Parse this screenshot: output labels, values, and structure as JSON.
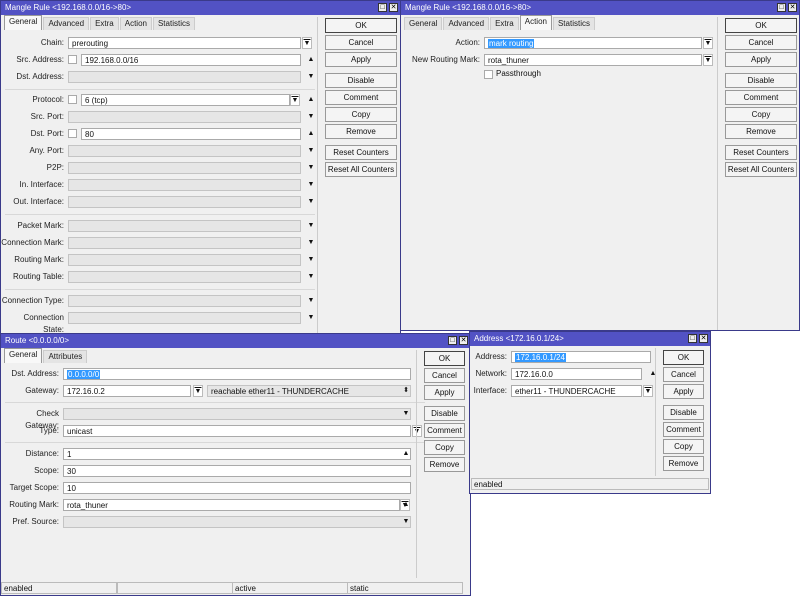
{
  "mangle_general": {
    "title": "Mangle Rule <192.168.0.0/16->80>",
    "tabs": [
      "General",
      "Advanced",
      "Extra",
      "Action",
      "Statistics"
    ],
    "active_tab": 0,
    "rows": [
      {
        "label": "Chain:",
        "value": "prerouting",
        "kind": "text",
        "arrow": "dropdown-icon"
      },
      {
        "label": "Src. Address:",
        "value": "192.168.0.0/16",
        "kind": "text",
        "checkbox": true,
        "arrow": "arrow-up-icon"
      },
      {
        "label": "Dst. Address:",
        "value": "",
        "kind": "empty",
        "arrow": "arrow-down-icon"
      },
      {
        "label": "Protocol:",
        "value": "6 (tcp)",
        "kind": "text",
        "checkbox": true,
        "arrow": "arrow-up-icon",
        "dropdown": true
      },
      {
        "label": "Src. Port:",
        "value": "",
        "kind": "empty",
        "arrow": "arrow-down-icon"
      },
      {
        "label": "Dst. Port:",
        "value": "80",
        "kind": "text",
        "checkbox": true,
        "arrow": "arrow-up-icon"
      },
      {
        "label": "Any. Port:",
        "value": "",
        "kind": "empty",
        "arrow": "arrow-down-icon"
      },
      {
        "label": "P2P:",
        "value": "",
        "kind": "empty",
        "arrow": "arrow-down-icon"
      },
      {
        "label": "In. Interface:",
        "value": "",
        "kind": "empty",
        "arrow": "arrow-down-icon"
      },
      {
        "label": "Out. Interface:",
        "value": "",
        "kind": "empty",
        "arrow": "arrow-down-icon"
      },
      {
        "label": "Packet Mark:",
        "value": "",
        "kind": "empty",
        "arrow": "arrow-down-icon"
      },
      {
        "label": "Connection Mark:",
        "value": "",
        "kind": "empty",
        "arrow": "arrow-down-icon"
      },
      {
        "label": "Routing Mark:",
        "value": "",
        "kind": "empty",
        "arrow": "arrow-down-icon"
      },
      {
        "label": "Routing Table:",
        "value": "",
        "kind": "empty",
        "arrow": "arrow-down-icon"
      },
      {
        "label": "Connection Type:",
        "value": "",
        "kind": "empty",
        "arrow": "arrow-down-icon"
      },
      {
        "label": "Connection State:",
        "value": "",
        "kind": "empty",
        "arrow": "arrow-down-icon"
      }
    ],
    "buttons": [
      "OK",
      "Cancel",
      "Apply",
      "Disable",
      "Comment",
      "Copy",
      "Remove",
      "Reset Counters",
      "Reset All Counters"
    ]
  },
  "mangle_action": {
    "title": "Mangle Rule <192.168.0.0/16->80>",
    "tabs": [
      "General",
      "Advanced",
      "Extra",
      "Action",
      "Statistics"
    ],
    "active_tab": 3,
    "rows": [
      {
        "label": "Action:",
        "value": "mark routing",
        "kind": "text",
        "selected": true,
        "arrow": "dropdown-icon"
      },
      {
        "label": "New Routing Mark:",
        "value": "rota_thuner",
        "kind": "text",
        "arrow": "dropdown-icon"
      }
    ],
    "passthrough_label": "Passthrough",
    "passthrough_checked": false,
    "buttons": [
      "OK",
      "Cancel",
      "Apply",
      "Disable",
      "Comment",
      "Copy",
      "Remove",
      "Reset Counters",
      "Reset All Counters"
    ]
  },
  "route": {
    "title": "Route <0.0.0.0/0>",
    "tabs": [
      "General",
      "Attributes"
    ],
    "active_tab": 0,
    "rows": [
      {
        "label": "Dst. Address:",
        "value": "0.0.0.0/0",
        "kind": "text",
        "selected": true
      },
      {
        "label": "Gateway:",
        "value": "172.16.0.2",
        "kind": "text",
        "arrow": "dropdown-icon",
        "extra": "reachable ether11 - THUNDERCACHE",
        "extra_arrow": "arrow-updown-icon"
      },
      {
        "label": "Check Gateway:",
        "value": "",
        "kind": "empty",
        "arrow": "arrow-down-icon"
      },
      {
        "label": "Type:",
        "value": "unicast",
        "kind": "text",
        "arrow": "dropdown-icon"
      },
      {
        "label": "Distance:",
        "value": "1",
        "kind": "text",
        "arrow": "arrow-up-icon"
      },
      {
        "label": "Scope:",
        "value": "30",
        "kind": "text"
      },
      {
        "label": "Target Scope:",
        "value": "10",
        "kind": "text"
      },
      {
        "label": "Routing Mark:",
        "value": "rota_thuner",
        "kind": "text",
        "arrow": "arrow-up-icon",
        "dropdown": true
      },
      {
        "label": "Pref. Source:",
        "value": "",
        "kind": "empty",
        "arrow": "arrow-down-icon"
      }
    ],
    "buttons": [
      "OK",
      "Cancel",
      "Apply",
      "Disable",
      "Comment",
      "Copy",
      "Remove"
    ],
    "status": [
      "enabled",
      "",
      "active",
      "static"
    ]
  },
  "address": {
    "title": "Address <172.16.0.1/24>",
    "rows": [
      {
        "label": "Address:",
        "value": "172.16.0.1/24",
        "kind": "text",
        "selected": true
      },
      {
        "label": "Network:",
        "value": "172.16.0.0",
        "kind": "text",
        "arrow": "arrow-up-icon"
      },
      {
        "label": "Interface:",
        "value": "ether11 - THUNDERCACHE",
        "kind": "text",
        "arrow": "dropdown-icon"
      }
    ],
    "buttons": [
      "OK",
      "Cancel",
      "Apply",
      "Disable",
      "Comment",
      "Copy",
      "Remove"
    ],
    "status": [
      "enabled"
    ]
  },
  "colors": {
    "titlebar": "#5252c4",
    "selection": "#3399ff"
  }
}
